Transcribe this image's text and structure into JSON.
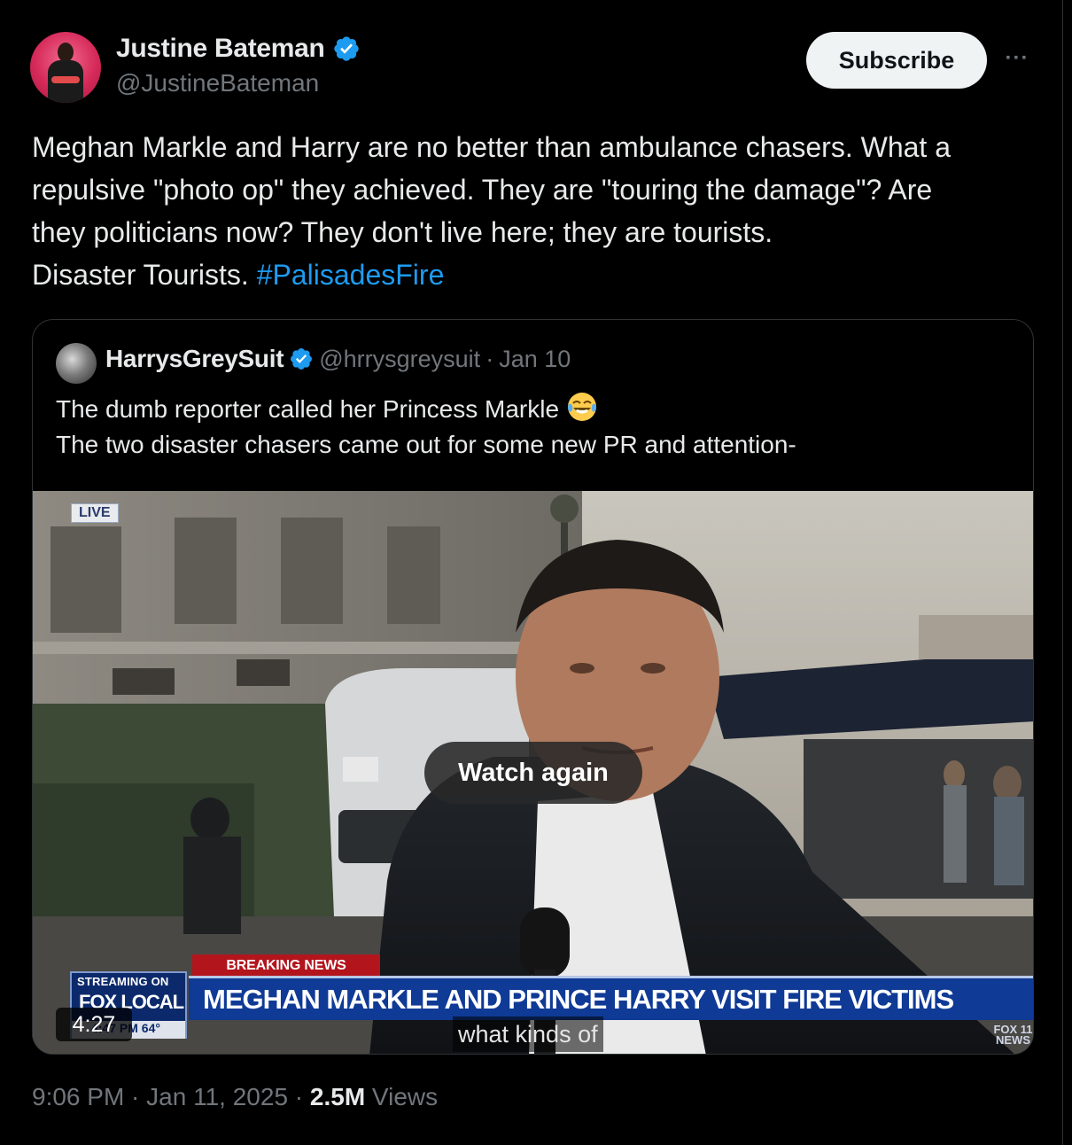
{
  "author": {
    "display_name": "Justine Bateman",
    "handle": "@JustineBateman",
    "verified": true
  },
  "actions": {
    "subscribe_label": "Subscribe",
    "more_label": "···"
  },
  "tweet": {
    "text_lines": [
      "Meghan Markle and Harry are no better than ambulance chasers. What a",
      "repulsive \"photo op\" they achieved. They are \"touring the damage\"? Are",
      "they politicians now? They don't live here; they are tourists.",
      "Disaster Tourists. "
    ],
    "hashtag": "#PalisadesFire"
  },
  "quoted": {
    "display_name": "HarrysGreySuit",
    "handle": "@hrrysgreysuit",
    "separator": "·",
    "date": "Jan 10",
    "verified": true,
    "line1": "The dumb reporter called her Princess Markle",
    "emoji": "face-with-tears-of-joy",
    "line2": "The two disaster chasers came out for some new PR and attention-"
  },
  "video": {
    "live_tag": "LIVE",
    "watch_again_label": "Watch again",
    "duration": "4:27",
    "breaking_label": "BREAKING NEWS",
    "streaming_label": "STREAMING ON",
    "network_label": "FOX LOCAL",
    "time_temp": "4:47 PM  64°",
    "headline": "MEGHAN MARKLE AND PRINCE HARRY VISIT FIRE VICTIMS",
    "caption": "what kinds of",
    "station_logo": "FOX 11 NEWS"
  },
  "footer": {
    "time": "9:06 PM",
    "sep1": " · ",
    "date": "Jan 11, 2025",
    "sep2": " · ",
    "views_count": "2.5M",
    "views_label": " Views"
  },
  "colors": {
    "background": "#000000",
    "accent": "#1d9bf0",
    "secondary_text": "#71767b",
    "primary_text": "#e7e9ea",
    "breaking_red": "#b3151c",
    "fox_blue": "#0f3a95"
  }
}
